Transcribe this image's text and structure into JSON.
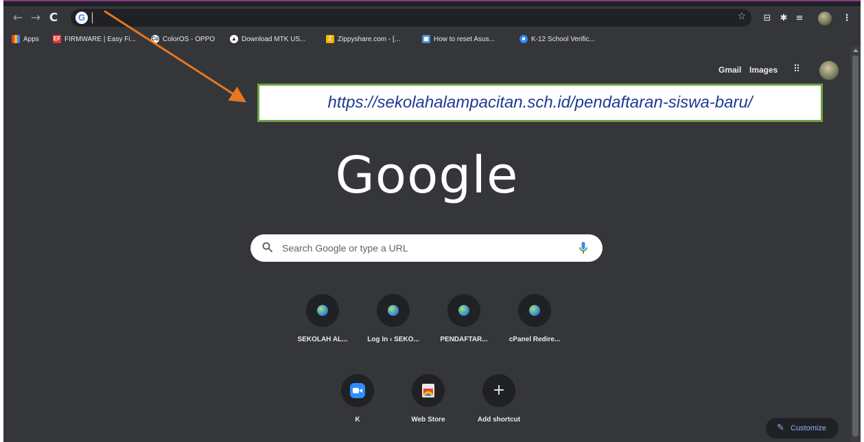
{
  "browser": {
    "omnibox_value": "",
    "bookmarks": [
      {
        "label": "Apps",
        "icon": "apps-grid-icon",
        "color": "#ea4335"
      },
      {
        "label": "FIRMWARE | Easy Fi...",
        "icon": "ef-favicon",
        "color": "#e53935",
        "badge": "EF"
      },
      {
        "label": "ColorOS - OPPO",
        "icon": "coloros-favicon",
        "color": "#ffffff",
        "badge": "Co"
      },
      {
        "label": "Download MTK US...",
        "icon": "mtk-favicon",
        "color": "#ffffff",
        "badge": "▲"
      },
      {
        "label": "Zippyshare.com - [...",
        "icon": "zippyshare-favicon",
        "color": "#f4b400",
        "badge": "Z"
      },
      {
        "label": "How to reset Asus...",
        "icon": "asus-favicon",
        "color": "#4a8fd6",
        "badge": "▦"
      },
      {
        "label": "K-12 School Verific...",
        "icon": "zoom-favicon",
        "color": "#2d8cff",
        "badge": "■"
      }
    ]
  },
  "ntp": {
    "gmail_label": "Gmail",
    "images_label": "Images",
    "logo_text": "Google",
    "search_placeholder": "Search Google or type a URL",
    "shortcuts": [
      {
        "label": "SEKOLAH AL...",
        "icon": "site-globe-icon"
      },
      {
        "label": "Log In ‹ SEKO...",
        "icon": "site-globe-icon"
      },
      {
        "label": "PENDAFTAR...",
        "icon": "site-globe-icon"
      },
      {
        "label": "cPanel Redire...",
        "icon": "site-globe-icon"
      }
    ],
    "shortcuts_row2": [
      {
        "label": "K",
        "icon": "zoom-video-icon"
      },
      {
        "label": "Web Store",
        "icon": "web-store-icon"
      },
      {
        "label": "Add shortcut",
        "icon": "plus-icon"
      }
    ],
    "customize_label": "Customize"
  },
  "annotation": {
    "url_text": "https://sekolahalampacitan.sch.id/pendaftaran-siswa-baru/",
    "arrow_color": "#e87722",
    "box_border_color": "#6ea344",
    "text_color": "#1f3a93"
  }
}
